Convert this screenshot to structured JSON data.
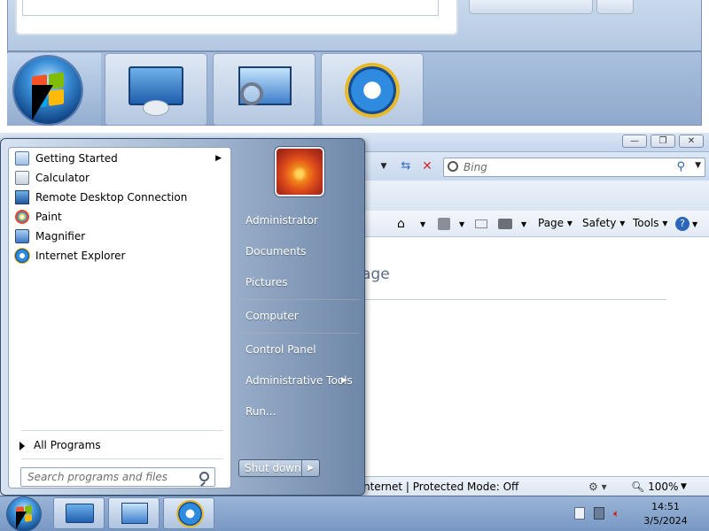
{
  "colors": {
    "taskbar": "#8aa8d0",
    "start_menu_left": "#ffffff",
    "start_menu_right": "#6f87a8",
    "accent": "#1f5fae"
  },
  "start_menu": {
    "programs": [
      {
        "label": "Getting Started",
        "icon": "getting-started-icon",
        "has_submenu": true
      },
      {
        "label": "Calculator",
        "icon": "calculator-icon",
        "has_submenu": false
      },
      {
        "label": "Remote Desktop Connection",
        "icon": "remote-desktop-icon",
        "has_submenu": false
      },
      {
        "label": "Paint",
        "icon": "paint-icon",
        "has_submenu": false
      },
      {
        "label": "Magnifier",
        "icon": "magnifier-icon",
        "has_submenu": false
      },
      {
        "label": "Internet Explorer",
        "icon": "internet-explorer-icon",
        "has_submenu": false
      }
    ],
    "all_programs_label": "All Programs",
    "search_placeholder": "Search programs and files",
    "right_items": [
      {
        "label": "Administrator"
      },
      {
        "label": "Documents"
      },
      {
        "label": "Pictures"
      },
      {
        "label": "Computer"
      },
      {
        "label": "Control Panel"
      },
      {
        "label": "Administrative Tools",
        "has_submenu": true
      },
      {
        "label": "Run..."
      }
    ],
    "shutdown_label": "Shut down"
  },
  "browser": {
    "search_placeholder": "Bing",
    "command_bar": {
      "page": "Page",
      "safety": "Safety",
      "tools": "Tools"
    },
    "page_heading_partial": "age",
    "status_text": "nternet | Protected Mode: Off",
    "zoom": "100%"
  },
  "taskbar": {
    "pinned": [
      {
        "name": "server-manager",
        "icon": "server-manager-icon"
      },
      {
        "name": "magnifier",
        "icon": "magnifier-icon"
      },
      {
        "name": "internet-explorer",
        "icon": "internet-explorer-icon"
      }
    ],
    "clock_time": "14:51",
    "clock_date": "3/5/2024"
  }
}
